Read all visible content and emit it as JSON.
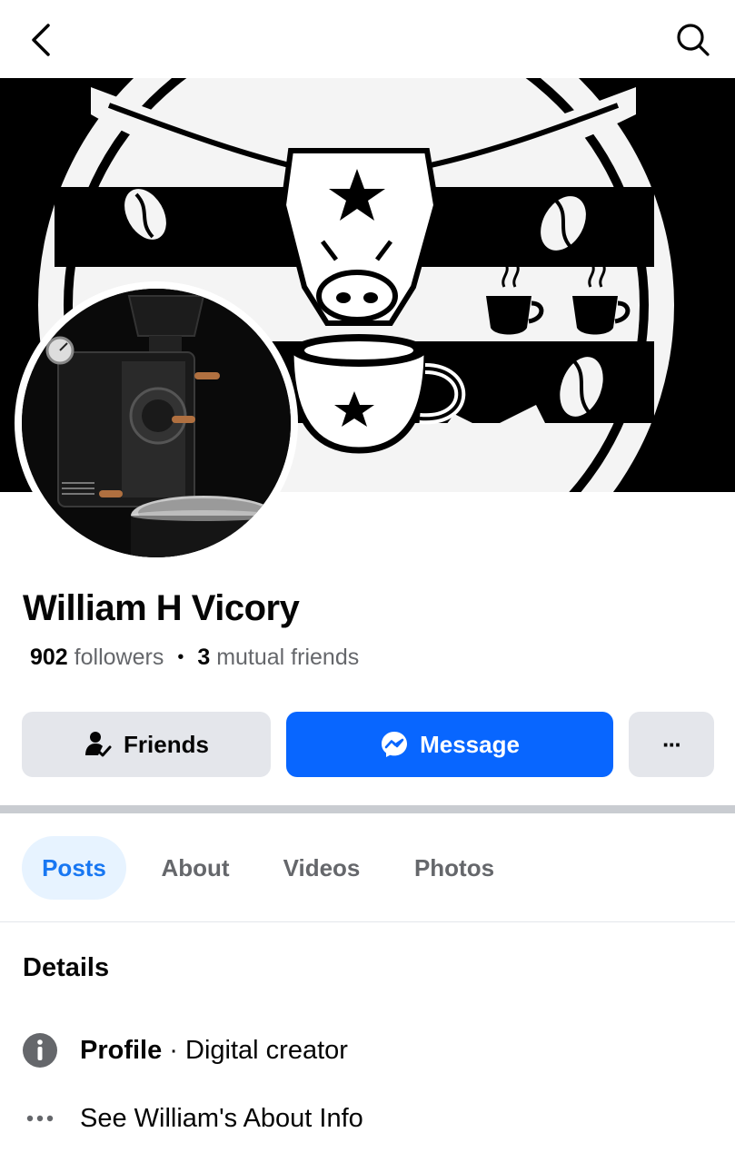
{
  "header": {
    "back_icon": "chevron-left-icon",
    "search_icon": "search-icon"
  },
  "profile": {
    "name": "William H Vicory",
    "followers_count": "902",
    "followers_label": "followers",
    "mutual_count": "3",
    "mutual_label": "mutual friends",
    "separator": "•"
  },
  "actions": {
    "friends_label": "Friends",
    "message_label": "Message",
    "more_label": "···"
  },
  "tabs": [
    {
      "label": "Posts",
      "active": true
    },
    {
      "label": "About",
      "active": false
    },
    {
      "label": "Videos",
      "active": false
    },
    {
      "label": "Photos",
      "active": false
    }
  ],
  "details": {
    "heading": "Details",
    "profile_label": "Profile",
    "profile_separator": " · ",
    "profile_value": "Digital creator",
    "about_link": "See William's About Info"
  },
  "colors": {
    "accent": "#0866ff",
    "active_tab_bg": "#e7f3ff",
    "active_tab_text": "#1877f2",
    "button_gray": "#e4e6eb",
    "secondary_text": "#65676b"
  }
}
